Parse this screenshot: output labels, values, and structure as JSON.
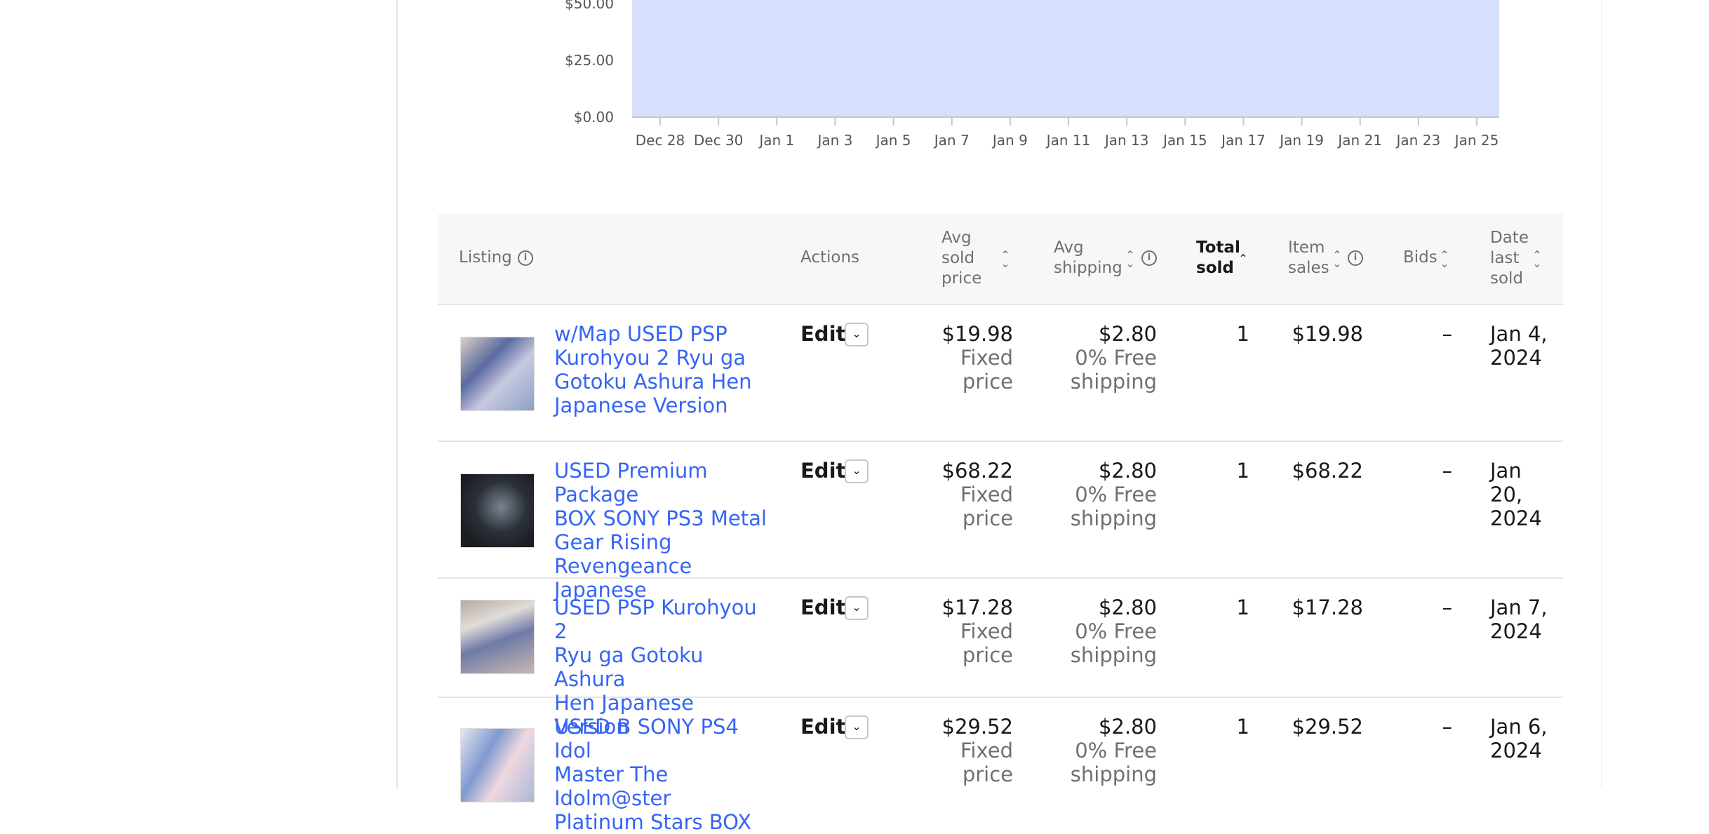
{
  "chart_data": {
    "type": "area",
    "y_tick_labels": [
      "$50.00",
      "$25.00",
      "$0.00"
    ],
    "y_ticks": [
      50,
      25,
      0
    ],
    "x_tick_labels": [
      "Dec 28",
      "Dec 30",
      "Jan 1",
      "Jan 3",
      "Jan 5",
      "Jan 7",
      "Jan 9",
      "Jan 11",
      "Jan 13",
      "Jan 15",
      "Jan 17",
      "Jan 19",
      "Jan 21",
      "Jan 23",
      "Jan 25"
    ],
    "fill_color": "#d6e0fd",
    "grid": false
  },
  "table": {
    "headers": {
      "listing": "Listing",
      "actions": "Actions",
      "avg_sold_price": [
        "Avg",
        "sold",
        "price"
      ],
      "avg_shipping": [
        "Avg",
        "shipping"
      ],
      "total_sold": [
        "Total",
        "sold"
      ],
      "item_sales": [
        "Item",
        "sales"
      ],
      "bids": "Bids",
      "date_last_sold": [
        "Date",
        "last",
        "sold"
      ]
    },
    "rows": [
      {
        "title": [
          "w/Map USED PSP",
          "Kurohyou 2 Ryu ga",
          "Gotoku Ashura Hen",
          "Japanese Version"
        ],
        "edit": "Edit",
        "avg_price": "$19.98",
        "price_type": [
          "Fixed",
          "price"
        ],
        "avg_shipping": "$2.80",
        "shipping_note": [
          "0% Free",
          "shipping"
        ],
        "total_sold": "1",
        "item_sales": "$19.98",
        "bids": "–",
        "date": [
          "Jan 4,",
          "2024"
        ]
      },
      {
        "title": [
          "USED Premium Package",
          "BOX SONY PS3 Metal",
          "Gear Rising",
          "Revengeance Japanese"
        ],
        "edit": "Edit",
        "avg_price": "$68.22",
        "price_type": [
          "Fixed",
          "price"
        ],
        "avg_shipping": "$2.80",
        "shipping_note": [
          "0% Free",
          "shipping"
        ],
        "total_sold": "1",
        "item_sales": "$68.22",
        "bids": "–",
        "date": [
          "Jan",
          "20,",
          "2024"
        ]
      },
      {
        "title": [
          "USED PSP Kurohyou 2",
          "Ryu ga Gotoku Ashura",
          "Hen Japanese Version"
        ],
        "edit": "Edit",
        "avg_price": "$17.28",
        "price_type": [
          "Fixed",
          "price"
        ],
        "avg_shipping": "$2.80",
        "shipping_note": [
          "0% Free",
          "shipping"
        ],
        "total_sold": "1",
        "item_sales": "$17.28",
        "bids": "–",
        "date": [
          "Jan 7,",
          "2024"
        ]
      },
      {
        "title": [
          "USED B SONY PS4 Idol",
          "Master The Idolm@ster",
          "Platinum Stars BOX"
        ],
        "edit": "Edit",
        "avg_price": "$29.52",
        "price_type": [
          "Fixed",
          "price"
        ],
        "avg_shipping": "$2.80",
        "shipping_note": [
          "0% Free",
          "shipping"
        ],
        "total_sold": "1",
        "item_sales": "$29.52",
        "bids": "–",
        "date": [
          "Jan 6,",
          "2024"
        ]
      }
    ]
  },
  "icons": {
    "info": "info-icon",
    "sort": "sort-icon",
    "sort_asc": "sort-ascending-icon",
    "dropdown": "chevron-down-icon"
  }
}
